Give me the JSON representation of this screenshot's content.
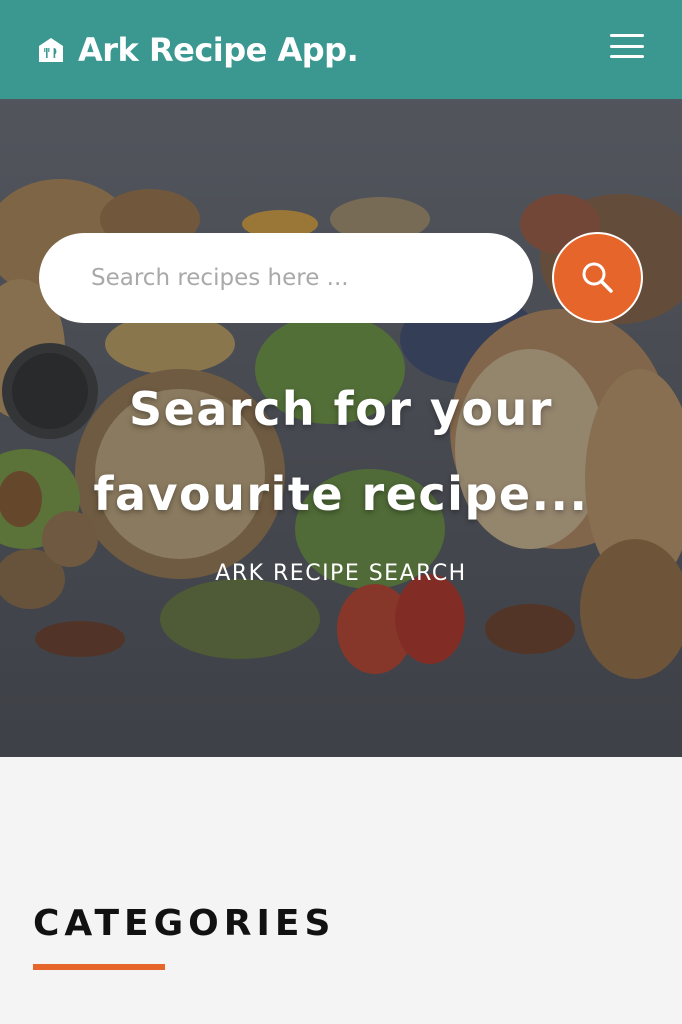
{
  "app": {
    "title": "Ark Recipe App.",
    "brand_icon": "home-food-icon",
    "menu_icon": "hamburger-menu-icon"
  },
  "colors": {
    "header": "#3b9890",
    "accent": "#e5652a",
    "page_bg": "#f4f4f4"
  },
  "search": {
    "placeholder": "Search recipes here ...",
    "value": "",
    "button_icon": "search-icon"
  },
  "hero": {
    "heading_line1": "Search for your",
    "heading_line2": "favourite recipe...",
    "subtitle": "ARK RECIPE SEARCH"
  },
  "categories": {
    "title": "CATEGORIES"
  }
}
